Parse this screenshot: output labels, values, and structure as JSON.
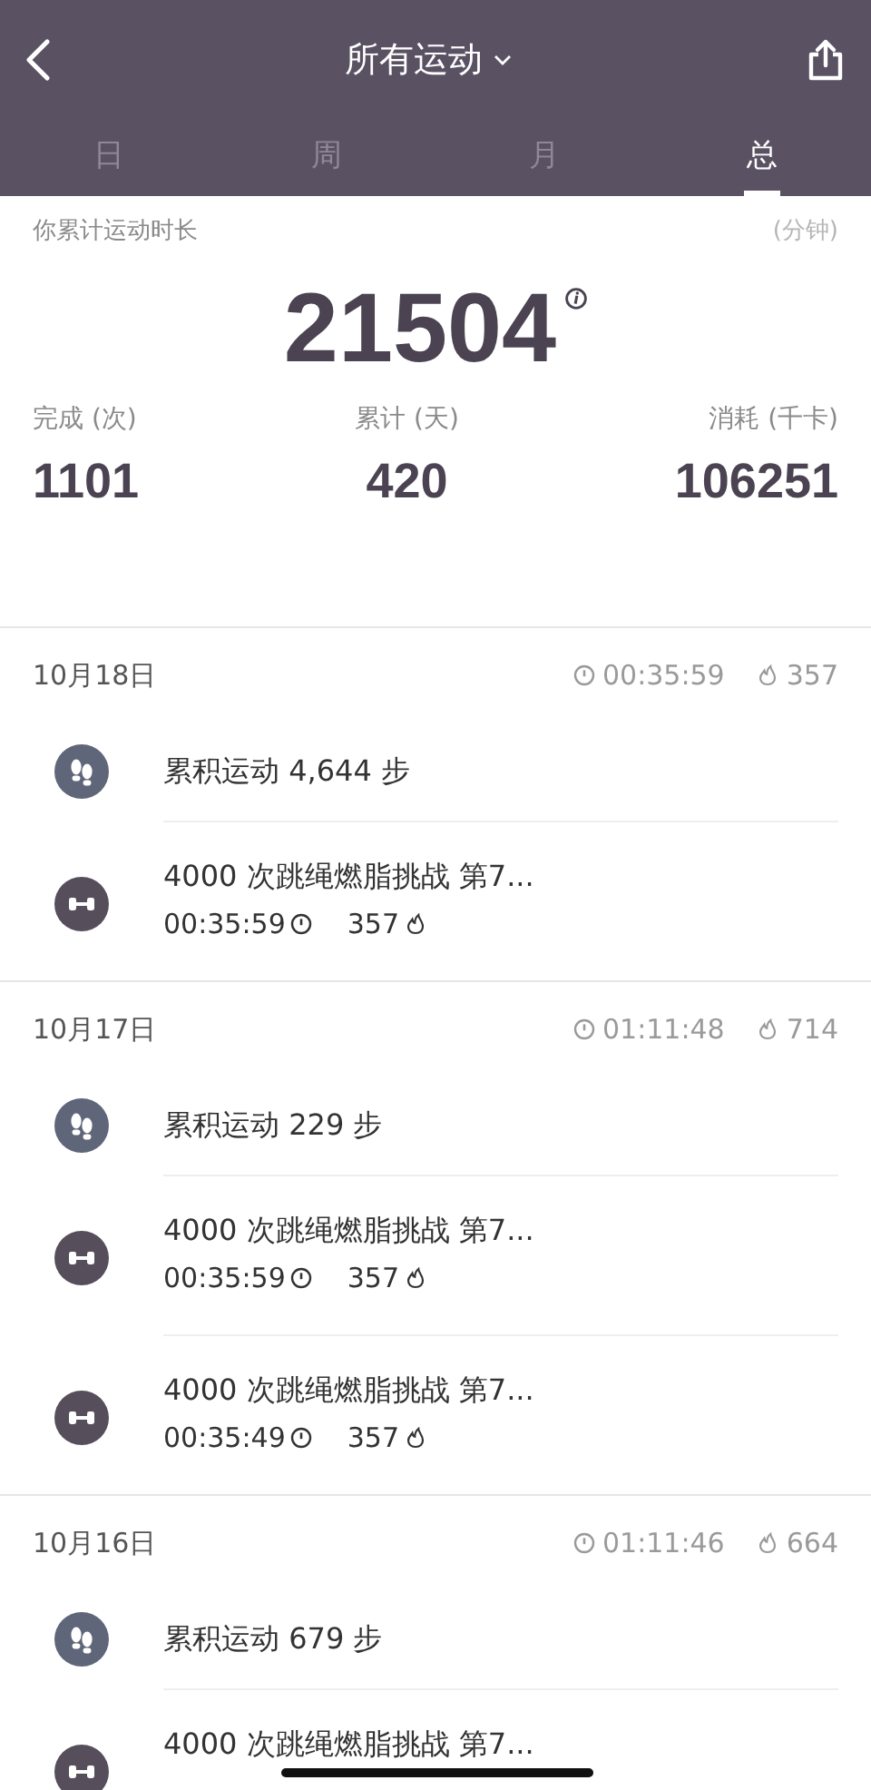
{
  "header": {
    "title": "所有运动",
    "tabs": [
      {
        "label": "日",
        "selected": false
      },
      {
        "label": "周",
        "selected": false
      },
      {
        "label": "月",
        "selected": false
      },
      {
        "label": "总",
        "selected": true
      }
    ]
  },
  "summary": {
    "label": "你累计运动时长",
    "unit": "(分钟)",
    "total": "21504",
    "stats": [
      {
        "label": "完成 (次)",
        "value": "1101"
      },
      {
        "label": "累计 (天)",
        "value": "420"
      },
      {
        "label": "消耗 (千卡)",
        "value": "106251"
      }
    ]
  },
  "days": [
    {
      "date": "10月18日",
      "duration": "00:35:59",
      "calories": "357",
      "items": [
        {
          "kind": "steps",
          "title": "累积运动 4,644 步"
        },
        {
          "kind": "workout",
          "title": "4000 次跳绳燃脂挑战  第7...",
          "duration": "00:35:59",
          "calories": "357"
        }
      ]
    },
    {
      "date": "10月17日",
      "duration": "01:11:48",
      "calories": "714",
      "items": [
        {
          "kind": "steps",
          "title": "累积运动 229 步"
        },
        {
          "kind": "workout",
          "title": "4000 次跳绳燃脂挑战  第7...",
          "duration": "00:35:59",
          "calories": "357"
        },
        {
          "kind": "workout",
          "title": "4000 次跳绳燃脂挑战  第7...",
          "duration": "00:35:49",
          "calories": "357"
        }
      ]
    },
    {
      "date": "10月16日",
      "duration": "01:11:46",
      "calories": "664",
      "items": [
        {
          "kind": "steps",
          "title": "累积运动 679 步"
        },
        {
          "kind": "workout",
          "title": "4000 次跳绳燃脂挑战  第7..."
        }
      ]
    }
  ]
}
